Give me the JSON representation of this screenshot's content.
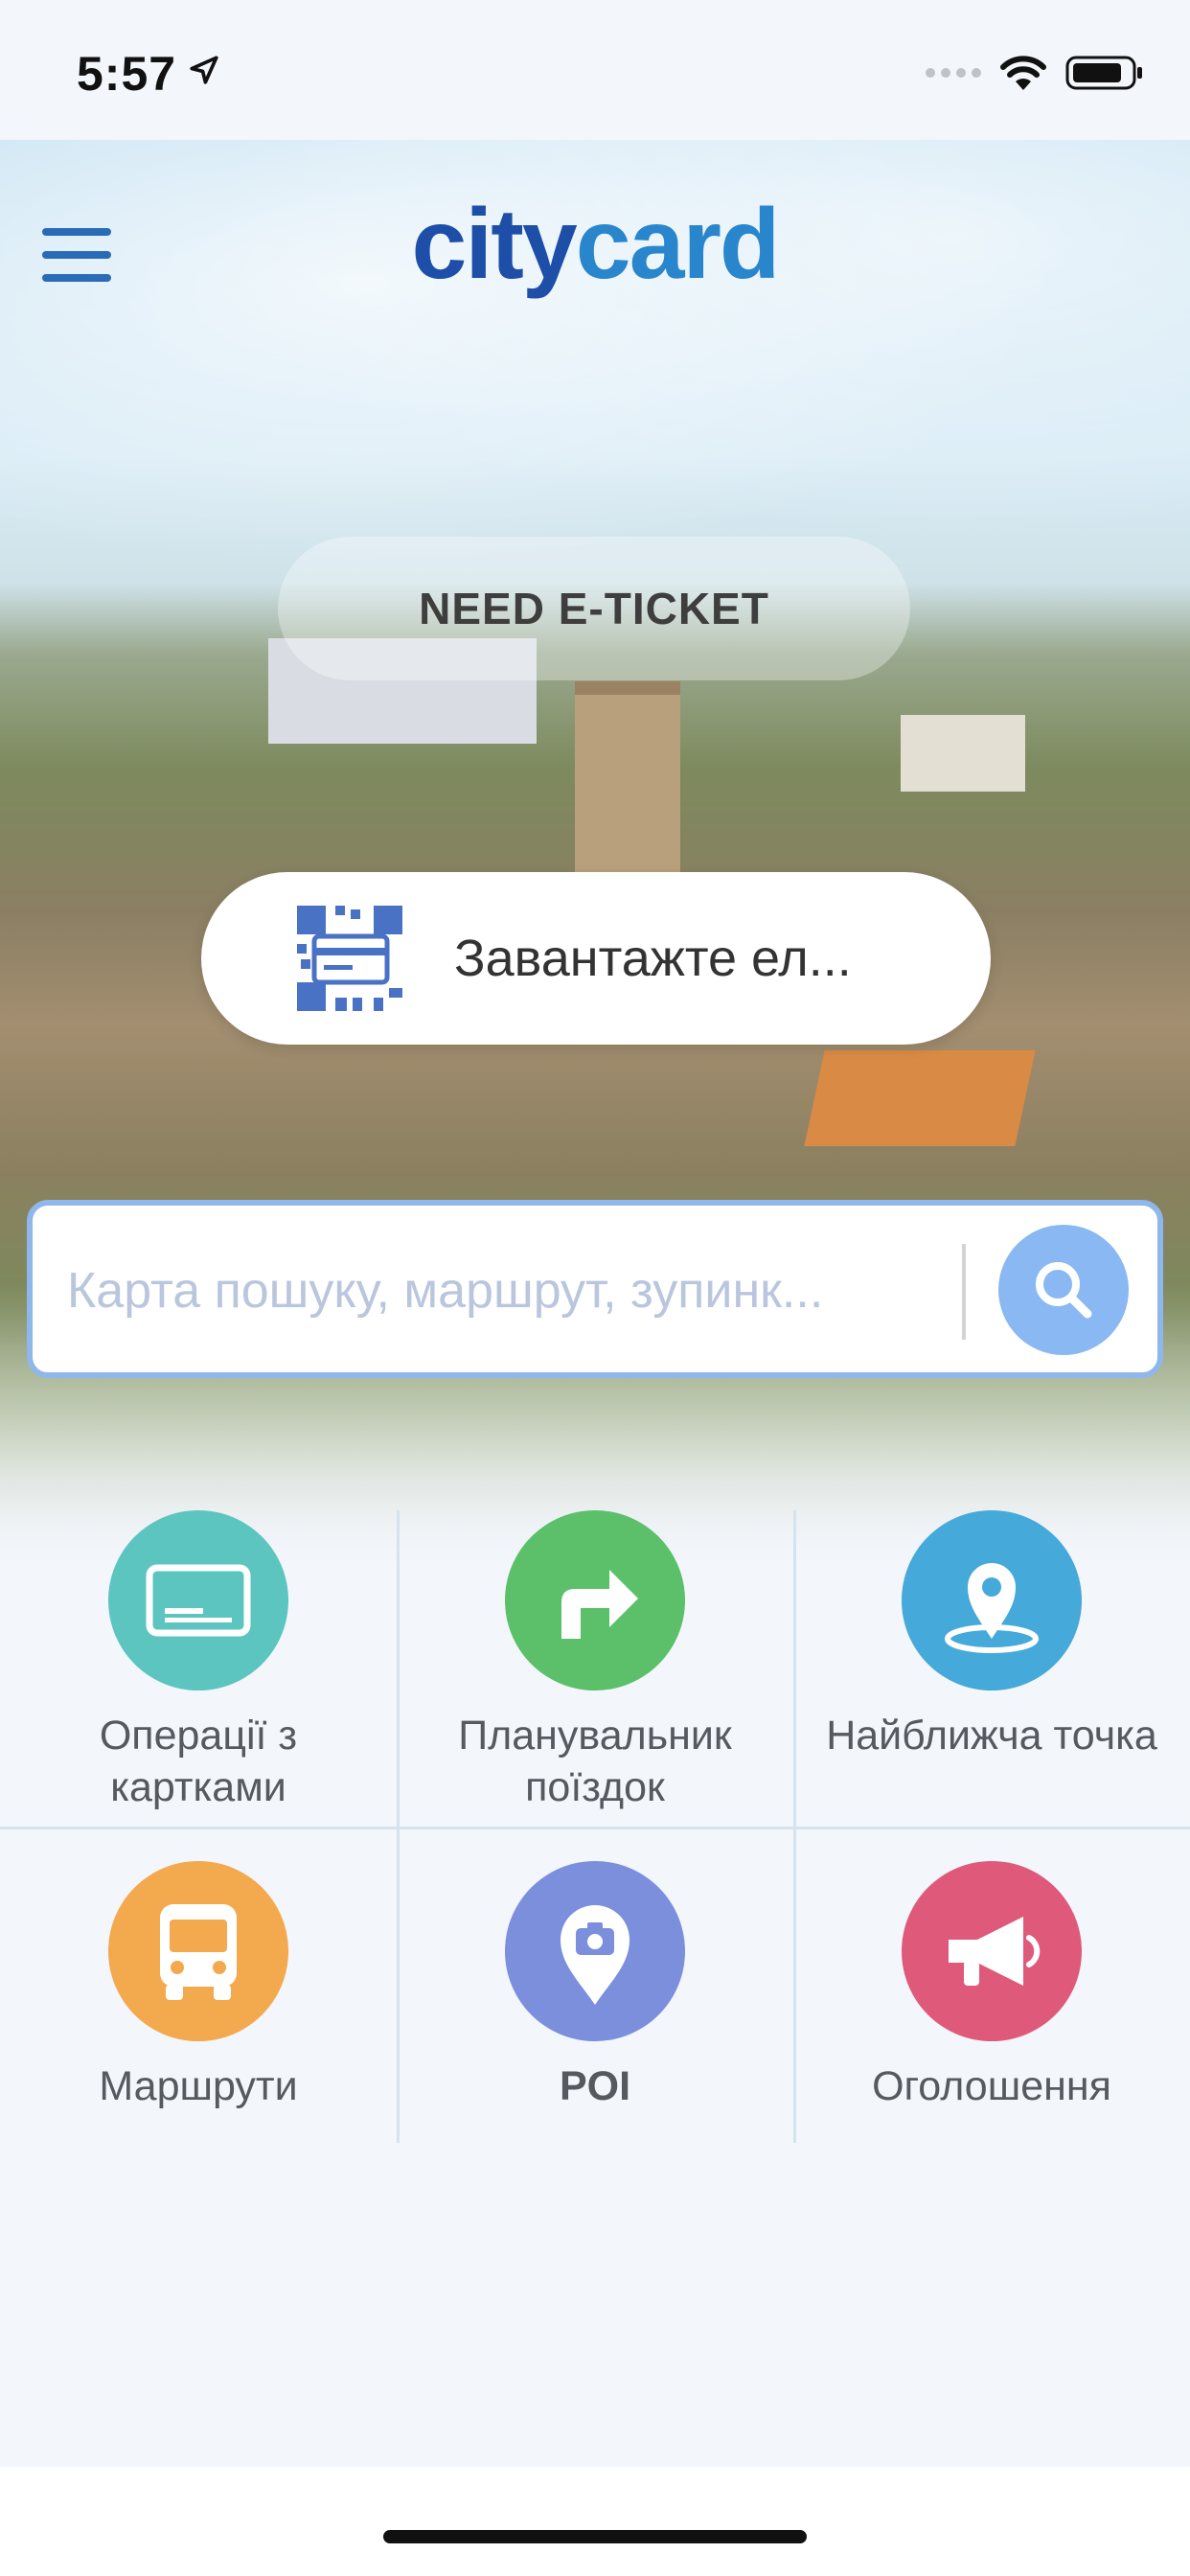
{
  "status_bar": {
    "time": "5:57",
    "icons": [
      "location-arrow-icon",
      "signal-dots-icon",
      "wifi-icon",
      "battery-icon"
    ]
  },
  "header": {
    "logo_part1": "city",
    "logo_part2": "card",
    "menu_icon": "hamburger-menu-icon"
  },
  "promo": {
    "need_ticket_label": "NEED E-TICKET",
    "download_label": "Завантажте ел...",
    "download_icon": "qr-code-card-icon"
  },
  "search": {
    "placeholder": "Карта пошуку, маршрут, зупинк...",
    "value": "",
    "button_icon": "search-icon"
  },
  "tiles": [
    {
      "label": "Операції з\nкартками",
      "icon": "card-icon",
      "color": "#5cc5c0"
    },
    {
      "label": "Планувальник\nпоїздок",
      "icon": "route-arrow-icon",
      "color": "#5cc06b"
    },
    {
      "label": "Найближча точка",
      "icon": "map-pin-icon",
      "color": "#45a9d9"
    },
    {
      "label": "Маршрути",
      "icon": "bus-icon",
      "color": "#f3a94d"
    },
    {
      "label": "POI",
      "icon": "camera-pin-icon",
      "color": "#7b8fdc"
    },
    {
      "label": "Оголошення",
      "icon": "megaphone-icon",
      "color": "#df5a7a"
    }
  ],
  "colors": {
    "brand_dark": "#1e4fa8",
    "brand_light": "#2a86cc",
    "search_border": "#8fb7ec",
    "search_button": "#8ab8f2"
  }
}
